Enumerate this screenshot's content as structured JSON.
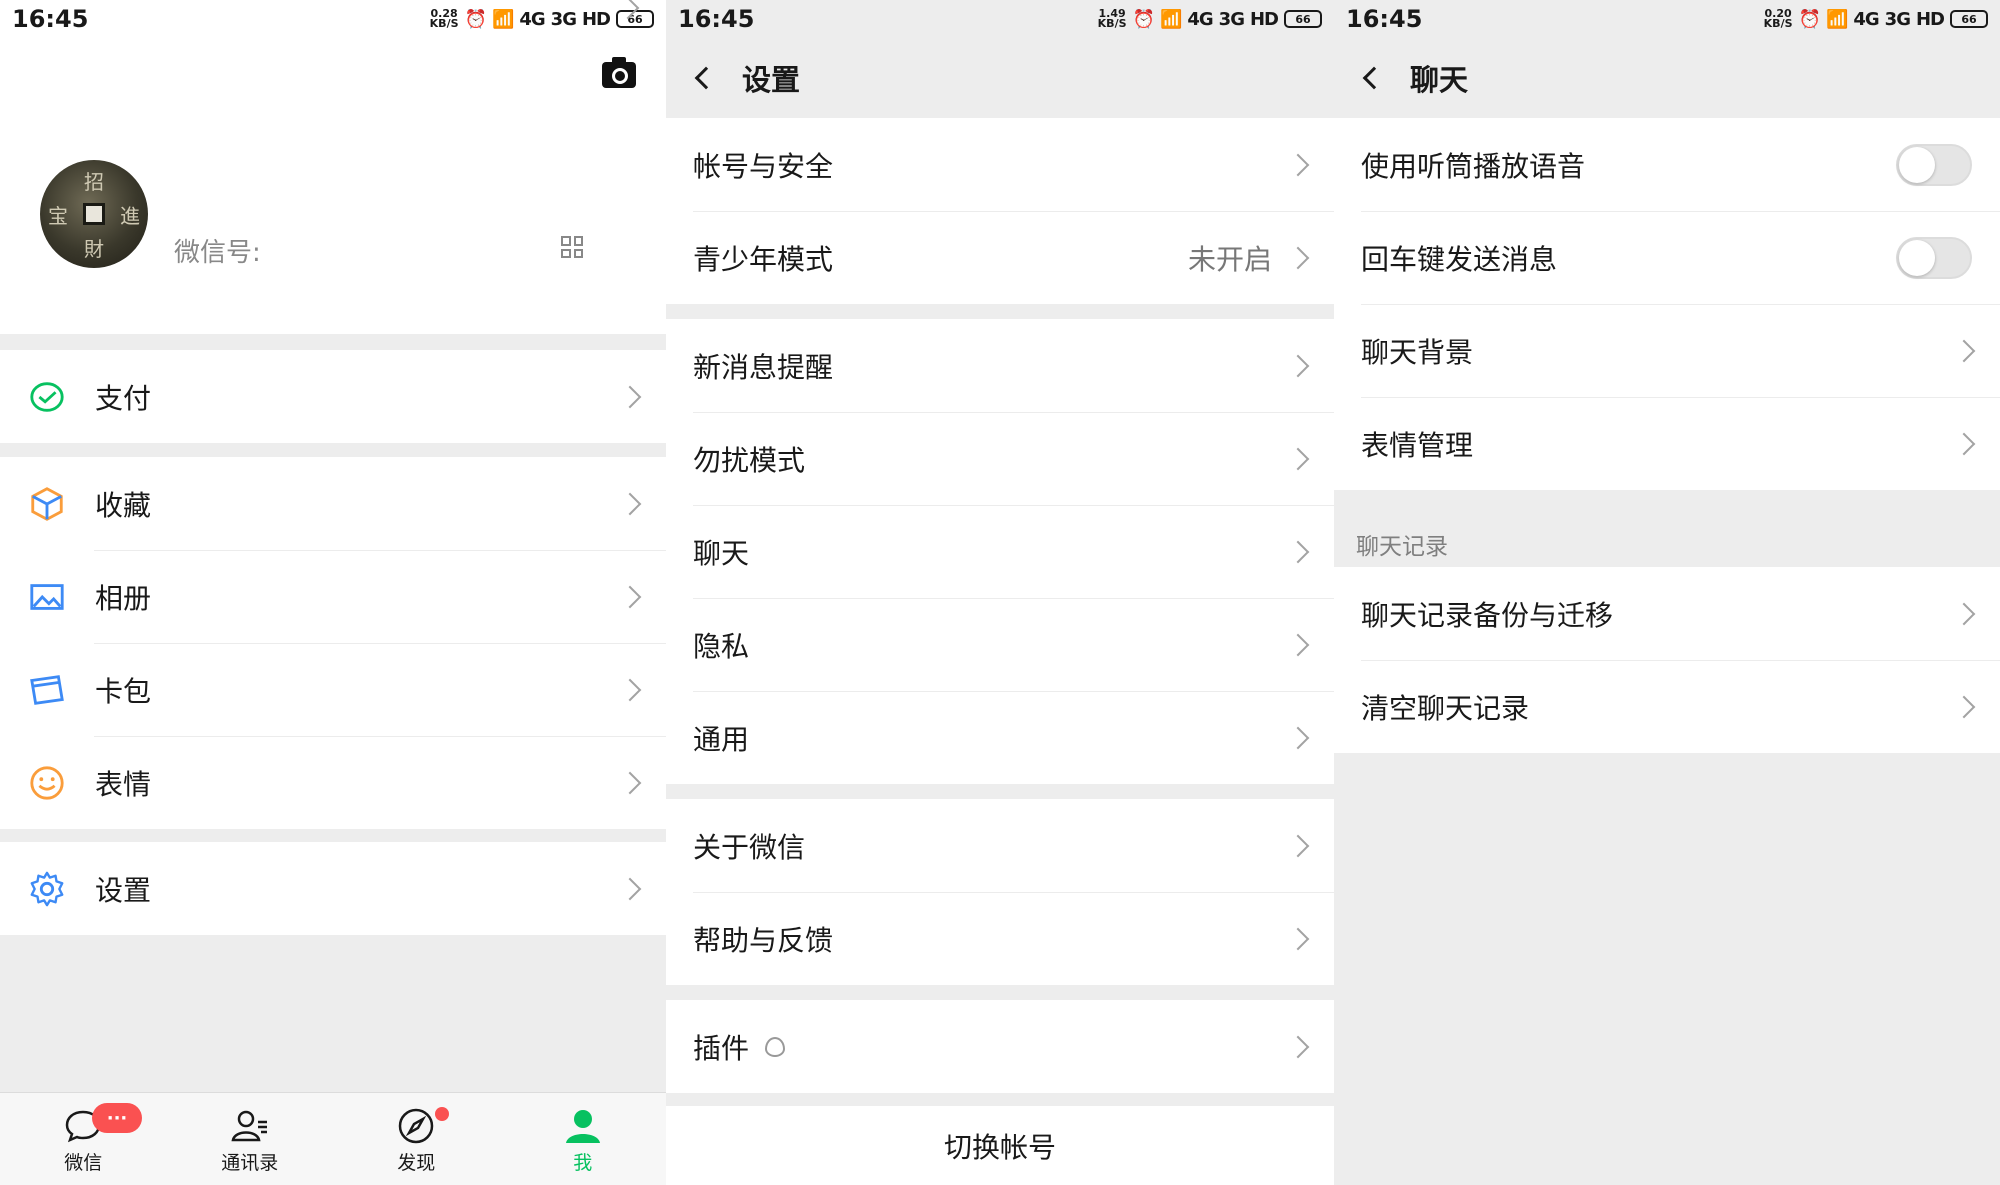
{
  "status": {
    "time": "16:45",
    "panels": [
      {
        "speed_top": "0.28",
        "speed_unit": "KB/S",
        "net1": "4G",
        "net2": "3G",
        "hd": "HD",
        "battery": "66"
      },
      {
        "speed_top": "1.49",
        "speed_unit": "KB/S",
        "net1": "4G",
        "net2": "3G",
        "hd": "HD",
        "battery": "66"
      },
      {
        "speed_top": "0.20",
        "speed_unit": "KB/S",
        "net1": "4G",
        "net2": "3G",
        "hd": "HD",
        "battery": "66"
      }
    ]
  },
  "me": {
    "wechat_id_label": "微信号:",
    "avatar_chars": [
      "招",
      "宝",
      "進",
      "財"
    ],
    "groups": [
      {
        "items": [
          {
            "label": "支付",
            "icon": "pay-icon"
          }
        ]
      },
      {
        "items": [
          {
            "label": "收藏",
            "icon": "favorites-icon"
          },
          {
            "label": "相册",
            "icon": "album-icon"
          },
          {
            "label": "卡包",
            "icon": "card-package-icon"
          },
          {
            "label": "表情",
            "icon": "sticker-icon"
          }
        ]
      },
      {
        "items": [
          {
            "label": "设置",
            "icon": "gear-icon"
          }
        ]
      }
    ],
    "tabs": [
      {
        "label": "微信",
        "icon": "chat-icon",
        "badge": "···"
      },
      {
        "label": "通讯录",
        "icon": "contacts-icon"
      },
      {
        "label": "发现",
        "icon": "discover-icon"
      },
      {
        "label": "我",
        "icon": "me-icon",
        "active": true
      }
    ],
    "colors": {
      "accent": "#07c160",
      "badge": "#fa5151"
    }
  },
  "settings": {
    "title": "设置",
    "groups": [
      {
        "items": [
          {
            "label": "帐号与安全"
          },
          {
            "label": "青少年模式",
            "value": "未开启"
          }
        ]
      },
      {
        "items": [
          {
            "label": "新消息提醒"
          },
          {
            "label": "勿扰模式"
          },
          {
            "label": "聊天"
          },
          {
            "label": "隐私"
          },
          {
            "label": "通用"
          }
        ]
      },
      {
        "items": [
          {
            "label": "关于微信"
          },
          {
            "label": "帮助与反馈"
          }
        ]
      },
      {
        "items": [
          {
            "label": "插件"
          }
        ]
      }
    ],
    "switch_account": "切换帐号"
  },
  "chat": {
    "title": "聊天",
    "toggles": [
      {
        "label": "使用听筒播放语音",
        "on": false
      },
      {
        "label": "回车键发送消息",
        "on": false
      }
    ],
    "items": [
      {
        "label": "聊天背景"
      },
      {
        "label": "表情管理"
      }
    ],
    "history_section": "聊天记录",
    "history_items": [
      {
        "label": "聊天记录备份与迁移"
      },
      {
        "label": "清空聊天记录"
      }
    ]
  }
}
